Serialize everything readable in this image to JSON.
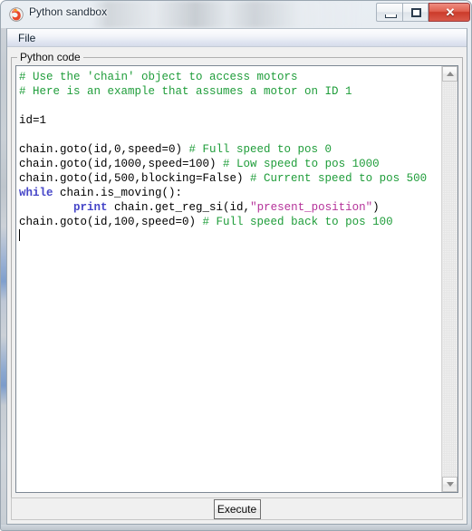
{
  "window": {
    "title": "Python sandbox",
    "icon": "python-app-icon",
    "buttons": {
      "minimize": "minimize-icon",
      "maximize": "maximize-icon",
      "close": "✕"
    }
  },
  "menubar": {
    "items": [
      {
        "label": "File"
      }
    ]
  },
  "groupbox": {
    "label": "Python code"
  },
  "editor": {
    "lines": [
      {
        "text": "# Use the 'chain' object to access motors",
        "type": "comment"
      },
      {
        "text": "# Here is an example that assumes a motor on ID 1",
        "type": "comment"
      },
      {
        "text": "",
        "type": "blank"
      },
      {
        "text": "id=1",
        "type": "code"
      },
      {
        "text": "",
        "type": "blank"
      },
      {
        "text": "chain.goto(id,0,speed=0) # Full speed to pos 0",
        "type": "code+comment"
      },
      {
        "text": "chain.goto(id,1000,speed=100) # Low speed to pos 1000",
        "type": "code+comment"
      },
      {
        "text": "chain.goto(id,500,blocking=False) # Current speed to pos 500",
        "type": "code+comment"
      },
      {
        "text": "while chain.is_moving():",
        "type": "code"
      },
      {
        "text": "        print chain.get_reg_si(id,\"present_position\")",
        "type": "code"
      },
      {
        "text": "chain.goto(id,100,speed=0) # Full speed back to pos 100",
        "type": "code+comment"
      }
    ],
    "segments": [
      [
        {
          "t": "# Use the 'chain' object to access motors",
          "c": "cm"
        }
      ],
      [
        {
          "t": "# Here is an example that assumes a motor on ID 1",
          "c": "cm"
        }
      ],
      [
        {
          "t": "",
          "c": ""
        }
      ],
      [
        {
          "t": "id=1",
          "c": ""
        }
      ],
      [
        {
          "t": "",
          "c": ""
        }
      ],
      [
        {
          "t": "chain.goto(id,0,speed=0) ",
          "c": ""
        },
        {
          "t": "# Full speed to pos 0",
          "c": "cm"
        }
      ],
      [
        {
          "t": "chain.goto(id,1000,speed=100) ",
          "c": ""
        },
        {
          "t": "# Low speed to pos 1000",
          "c": "cm"
        }
      ],
      [
        {
          "t": "chain.goto(id,500,blocking=False) ",
          "c": ""
        },
        {
          "t": "# Current speed to pos 500",
          "c": "cm"
        }
      ],
      [
        {
          "t": "while",
          "c": "kw"
        },
        {
          "t": " chain.is_moving():",
          "c": ""
        }
      ],
      [
        {
          "t": "        ",
          "c": ""
        },
        {
          "t": "print",
          "c": "kw"
        },
        {
          "t": " chain.get_reg_si(id,",
          "c": ""
        },
        {
          "t": "\"present_position\"",
          "c": "st"
        },
        {
          "t": ")",
          "c": ""
        }
      ],
      [
        {
          "t": "chain.goto(id,100,speed=0) ",
          "c": ""
        },
        {
          "t": "# Full speed back to pos 100",
          "c": "cm"
        }
      ]
    ],
    "cursor_line": 11,
    "colors": {
      "comment": "#1f9d3a",
      "keyword": "#4646c8",
      "string": "#b5329a",
      "text": "#000000",
      "background": "#ffffff"
    }
  },
  "scrollbar": {
    "up_arrow": "chevron-up-icon",
    "down_arrow": "chevron-down-icon"
  },
  "actions": {
    "execute_label": "Execute"
  }
}
